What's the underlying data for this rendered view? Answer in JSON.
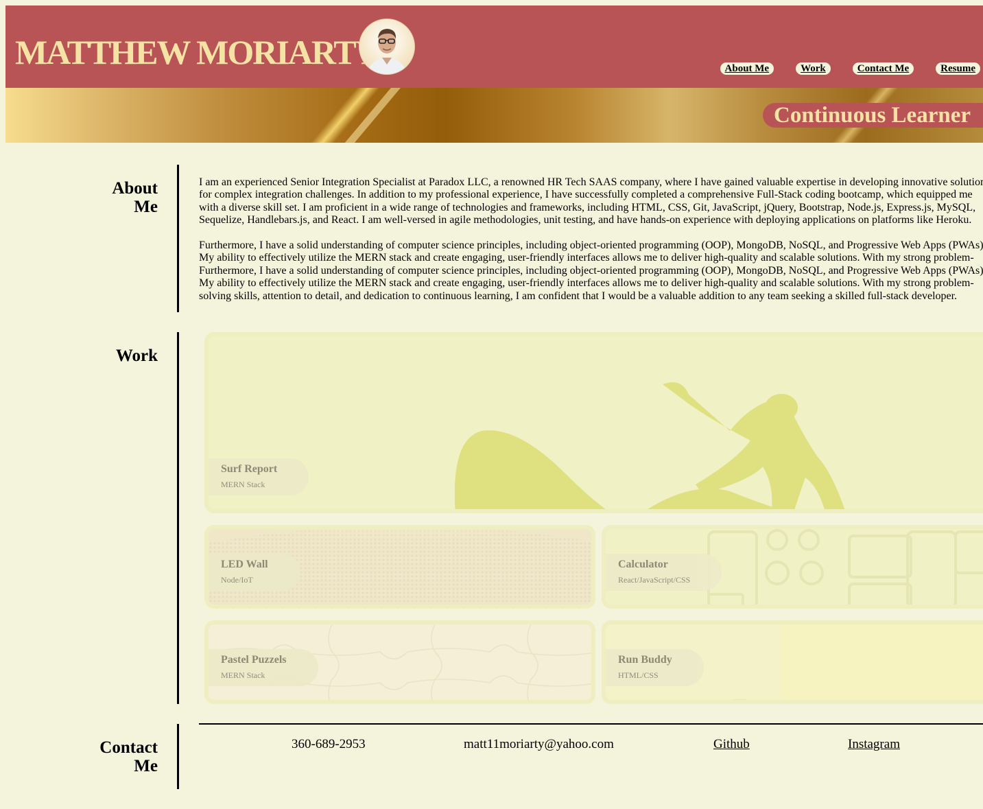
{
  "header": {
    "name": "MATTHEW MORIARTY",
    "nav": [
      {
        "label": "About Me"
      },
      {
        "label": "Work"
      },
      {
        "label": "Contact Me"
      },
      {
        "label": "Resume"
      }
    ]
  },
  "banner": {
    "tagline": "Continuous Learner"
  },
  "about": {
    "title": "About Me",
    "paragraphs": [
      "I am an experienced Senior Integration Specialist at Paradox LLC, a renowned HR Tech SAAS company, where I have gained valuable expertise in developing innovative solutions for complex integration challenges. In addition to my professional experience, I have successfully completed a comprehensive Full-Stack coding bootcamp, which equipped me with a diverse skill set. I am proficient in a wide range of technologies and frameworks, including HTML, CSS, Git, JavaScript, jQuery, Bootstrap, Node.js, Express.js, MySQL, Sequelize, Handlebars.js, and React. I am well-versed in agile methodologies, unit testing, and have hands-on experience with deploying applications on platforms like Heroku.",
      "Furthermore, I have a solid understanding of computer science principles, including object-oriented programming (OOP), MongoDB, NoSQL, and Progressive Web Apps (PWAs). My ability to effectively utilize the MERN stack and create engaging, user-friendly interfaces allows me to deliver high-quality and scalable solutions. With my strong problem-",
      "Furthermore, I have a solid understanding of computer science principles, including object-oriented programming (OOP), MongoDB, NoSQL, and Progressive Web Apps (PWAs). My ability to effectively utilize the MERN stack and create engaging, user-friendly interfaces allows me to deliver high-quality and scalable solutions. With my strong problem-solving skills, attention to detail, and dedication to continuous learning, I am confident that I would be a valuable addition to any team seeking a skilled full-stack developer."
    ]
  },
  "work": {
    "title": "Work",
    "projects": [
      {
        "title": "Surf Report",
        "stack": "MERN Stack"
      },
      {
        "title": "LED Wall",
        "stack": "Node/IoT"
      },
      {
        "title": "Calculator",
        "stack": "React/JavaScript/CSS"
      },
      {
        "title": "Pastel Puzzels",
        "stack": "MERN Stack"
      },
      {
        "title": "Run Buddy",
        "stack": "HTML/CSS"
      }
    ]
  },
  "contact": {
    "title": "Contact Me",
    "phone": "360-689-2953",
    "email": "matt11moriarty@yahoo.com",
    "github": "Github",
    "instagram": "Instagram"
  },
  "colors": {
    "header_bg": "#b85456",
    "title_color": "#f4e3a4",
    "page_bg": "#f4f4dc",
    "card_bg": "#f0f1c5"
  }
}
